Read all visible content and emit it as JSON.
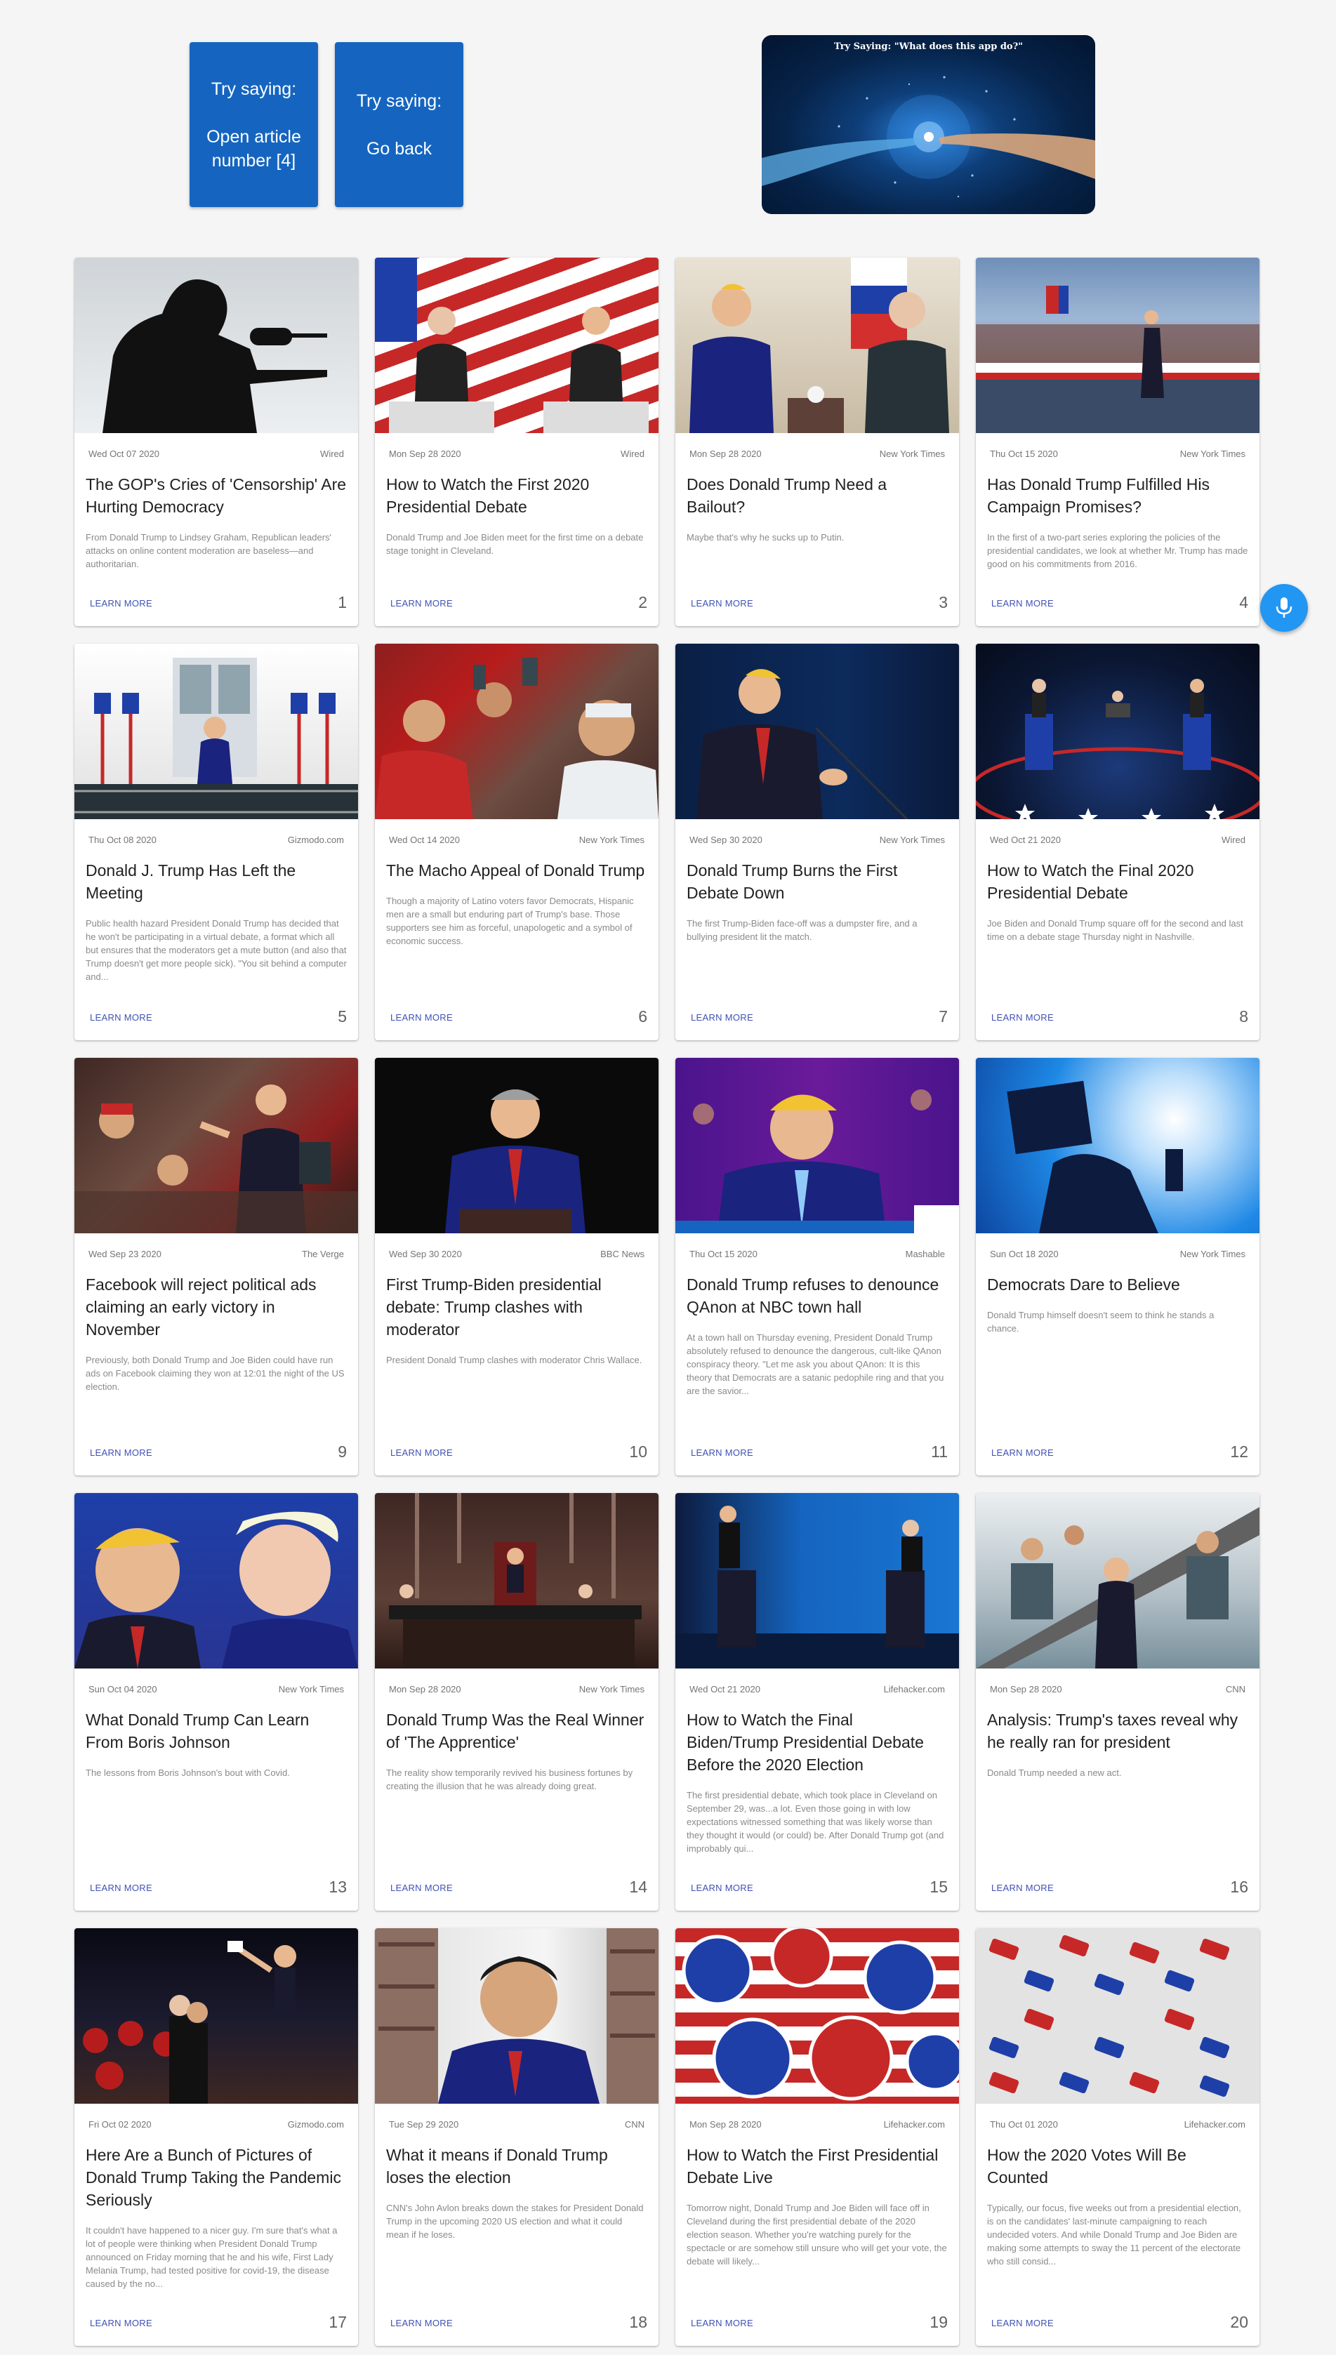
{
  "hints": [
    {
      "label": "Try saying:",
      "command": "Open article number [4]"
    },
    {
      "label": "Try saying:",
      "command": "Go back"
    }
  ],
  "banner": {
    "caption": "Try Saying: \"What does this app do?\""
  },
  "mic": {
    "icon": "microphone-icon"
  },
  "articles": [
    {
      "date": "Wed Oct 07 2020",
      "source": "Wired",
      "title": "The GOP's Cries of 'Censorship' Are Hurting Democracy",
      "description": "From Donald Trump to Lindsey Graham, Republican leaders' attacks on online content moderation are baseless—and authoritarian.",
      "more": "LEARN MORE",
      "number": "1"
    },
    {
      "date": "Mon Sep 28 2020",
      "source": "Wired",
      "title": "How to Watch the First 2020 Presidential Debate",
      "description": "Donald Trump and Joe Biden meet for the first time on a debate stage tonight in Cleveland.",
      "more": "LEARN MORE",
      "number": "2"
    },
    {
      "date": "Mon Sep 28 2020",
      "source": "New York Times",
      "title": "Does Donald Trump Need a Bailout?",
      "description": "Maybe that's why he sucks up to Putin.",
      "more": "LEARN MORE",
      "number": "3"
    },
    {
      "date": "Thu Oct 15 2020",
      "source": "New York Times",
      "title": "Has Donald Trump Fulfilled His Campaign Promises?",
      "description": "In the first of a two-part series exploring the policies of the presidential candidates, we look at whether Mr. Trump has made good on his commitments from 2016.",
      "more": "LEARN MORE",
      "number": "4"
    },
    {
      "date": "Thu Oct 08 2020",
      "source": "Gizmodo.com",
      "title": "Donald J. Trump Has Left the Meeting",
      "description": "Public health hazard President Donald Trump has decided that he won't be participating in a virtual debate, a format which all but ensures that the moderators get a mute button (and also that Trump doesn't get more people sick). \"You sit behind a computer and...",
      "more": "LEARN MORE",
      "number": "5"
    },
    {
      "date": "Wed Oct 14 2020",
      "source": "New York Times",
      "title": "The Macho Appeal of Donald Trump",
      "description": "Though a majority of Latino voters favor Democrats, Hispanic men are a small but enduring part of Trump's base. Those supporters see him as forceful, unapologetic and a symbol of economic success.",
      "more": "LEARN MORE",
      "number": "6"
    },
    {
      "date": "Wed Sep 30 2020",
      "source": "New York Times",
      "title": "Donald Trump Burns the First Debate Down",
      "description": "The first Trump-Biden face-off was a dumpster fire, and a bullying president lit the match.",
      "more": "LEARN MORE",
      "number": "7"
    },
    {
      "date": "Wed Oct 21 2020",
      "source": "Wired",
      "title": "How to Watch the Final 2020 Presidential Debate",
      "description": "Joe Biden and Donald Trump square off for the second and last time on a debate stage Thursday night in Nashville.",
      "more": "LEARN MORE",
      "number": "8"
    },
    {
      "date": "Wed Sep 23 2020",
      "source": "The Verge",
      "title": "Facebook will reject political ads claiming an early victory in November",
      "description": "Previously, both Donald Trump and Joe Biden could have run ads on Facebook claiming they won at 12:01 the night of the US election.",
      "more": "LEARN MORE",
      "number": "9"
    },
    {
      "date": "Wed Sep 30 2020",
      "source": "BBC News",
      "title": "First Trump-Biden presidential debate: Trump clashes with moderator",
      "description": "President Donald Trump clashes with moderator Chris Wallace.",
      "more": "LEARN MORE",
      "number": "10"
    },
    {
      "date": "Thu Oct 15 2020",
      "source": "Mashable",
      "title": "Donald Trump refuses to denounce QAnon at NBC town hall",
      "description": "At a town hall on Thursday evening, President Donald Trump absolutely refused to denounce the dangerous, cult-like QAnon conspiracy theory. \"Let me ask you about QAnon: It is this theory that Democrats are a satanic pedophile ring and that you are the savior...",
      "more": "LEARN MORE",
      "number": "11"
    },
    {
      "date": "Sun Oct 18 2020",
      "source": "New York Times",
      "title": "Democrats Dare to Believe",
      "description": "Donald Trump himself doesn't seem to think he stands a chance.",
      "more": "LEARN MORE",
      "number": "12"
    },
    {
      "date": "Sun Oct 04 2020",
      "source": "New York Times",
      "title": "What Donald Trump Can Learn From Boris Johnson",
      "description": "The lessons from Boris Johnson's bout with Covid.",
      "more": "LEARN MORE",
      "number": "13"
    },
    {
      "date": "Mon Sep 28 2020",
      "source": "New York Times",
      "title": "Donald Trump Was the Real Winner of 'The Apprentice'",
      "description": "The reality show temporarily revived his business fortunes by creating the illusion that he was already doing great.",
      "more": "LEARN MORE",
      "number": "14"
    },
    {
      "date": "Wed Oct 21 2020",
      "source": "Lifehacker.com",
      "title": "How to Watch the Final Biden/Trump Presidential Debate Before the 2020 Election",
      "description": "The first presidential debate, which took place in Cleveland on September 29, was...a lot. Even those going in with low expectations witnessed something that was likely worse than they thought it would (or could) be. After Donald Trump got (and improbably qui...",
      "more": "LEARN MORE",
      "number": "15"
    },
    {
      "date": "Mon Sep 28 2020",
      "source": "CNN",
      "title": "Analysis: Trump's taxes reveal why he really ran for president",
      "description": "Donald Trump needed a new act.",
      "more": "LEARN MORE",
      "number": "16"
    },
    {
      "date": "Fri Oct 02 2020",
      "source": "Gizmodo.com",
      "title": "Here Are a Bunch of Pictures of Donald Trump Taking the Pandemic Seriously",
      "description": "It couldn't have happened to a nicer guy. I'm sure that's what a lot of people were thinking when President Donald Trump announced on Friday morning that he and his wife, First Lady Melania Trump, had tested positive for covid-19, the disease caused by the no...",
      "more": "LEARN MORE",
      "number": "17"
    },
    {
      "date": "Tue Sep 29 2020",
      "source": "CNN",
      "title": "What it means if Donald Trump loses the election",
      "description": "CNN's John Avlon breaks down the stakes for President Donald Trump in the upcoming 2020 US election and what it could mean if he loses.",
      "more": "LEARN MORE",
      "number": "18"
    },
    {
      "date": "Mon Sep 28 2020",
      "source": "Lifehacker.com",
      "title": "How to Watch the First Presidential Debate Live",
      "description": "Tomorrow night, Donald Trump and Joe Biden will face off in Cleveland during the first presidential debate of the 2020 election season. Whether you're watching purely for the spectacle or are somehow still unsure who will get your vote, the debate will likely...",
      "more": "LEARN MORE",
      "number": "19"
    },
    {
      "date": "Thu Oct 01 2020",
      "source": "Lifehacker.com",
      "title": "How the 2020 Votes Will Be Counted",
      "description": "Typically, our focus, five weeks out from a presidential election, is on the candidates' last-minute campaigning to reach undecided voters. And while Donald Trump and Joe Biden are making some attempts to sway the 11 percent of the electorate who still consid...",
      "more": "LEARN MORE",
      "number": "20"
    }
  ]
}
